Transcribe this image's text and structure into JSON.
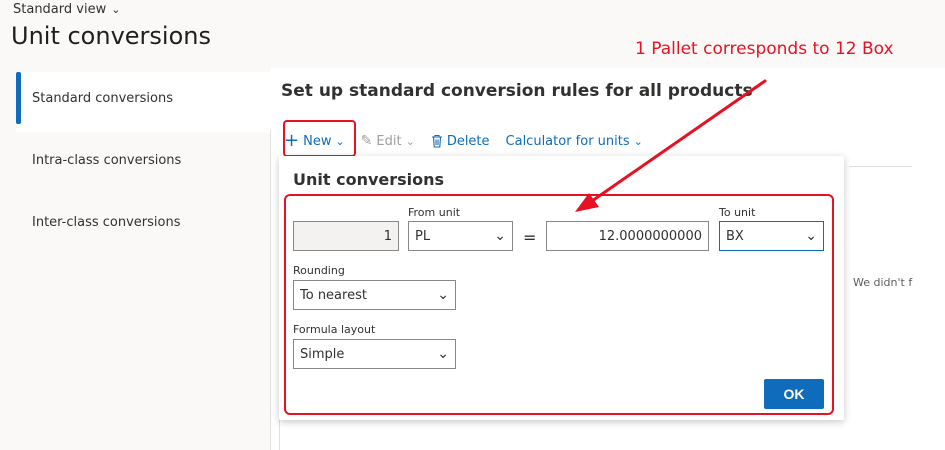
{
  "header": {
    "view_label": "Standard view",
    "title": "Unit conversions"
  },
  "nav": {
    "items": [
      {
        "label": "Standard conversions",
        "active": true
      },
      {
        "label": "Intra-class conversions",
        "active": false
      },
      {
        "label": "Inter-class conversions",
        "active": false
      }
    ]
  },
  "main": {
    "heading": "Set up standard conversion rules for all products",
    "toolbar": {
      "new_label": "New",
      "edit_label": "Edit",
      "delete_label": "Delete",
      "calculator_label": "Calculator for units"
    },
    "empty_note": "We didn't f"
  },
  "dialog": {
    "title": "Unit conversions",
    "quantity_value": "1",
    "from_unit": {
      "label": "From unit",
      "value": "PL"
    },
    "equals": "=",
    "factor_value": "12.0000000000",
    "to_unit": {
      "label": "To unit",
      "value": "BX"
    },
    "rounding": {
      "label": "Rounding",
      "value": "To nearest"
    },
    "formula_layout": {
      "label": "Formula layout",
      "value": "Simple"
    },
    "ok_label": "OK"
  },
  "annotation": {
    "text": "1 Pallet corresponds to 12 Box",
    "color": "#e81123"
  },
  "colors": {
    "accent": "#0f6cbd",
    "highlight": "#e81123"
  }
}
